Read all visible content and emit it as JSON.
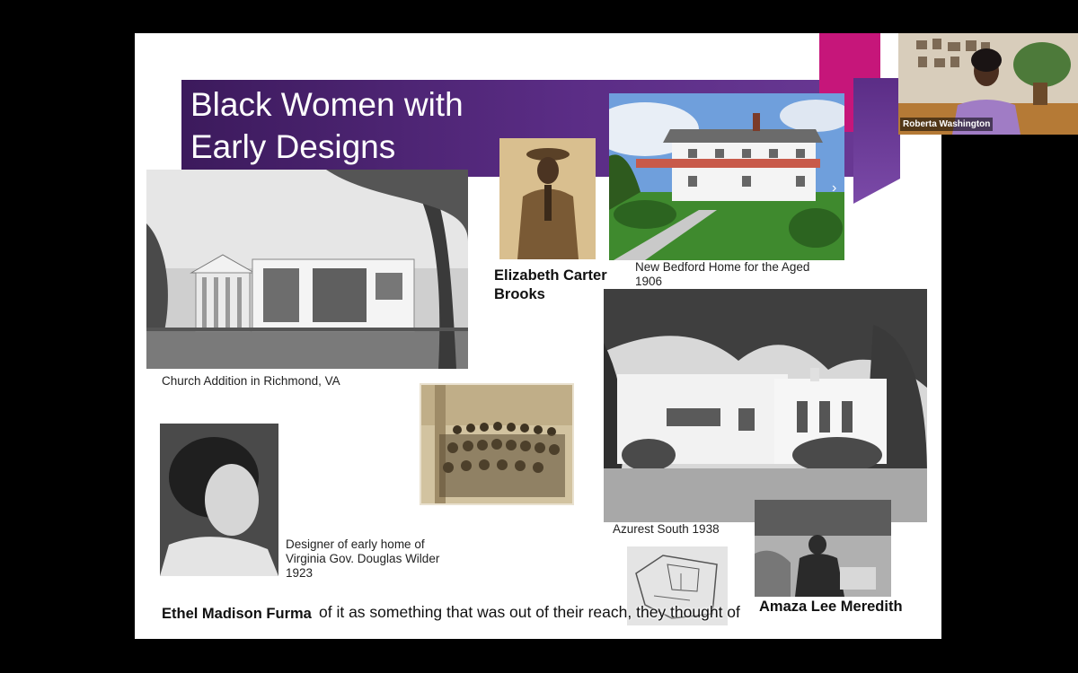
{
  "slide": {
    "title_line1": "Black Women with",
    "title_line2": "Early Designs",
    "captions": {
      "church": "Church Addition in Richmond, VA",
      "ecb_name": "Elizabeth Carter Brooks",
      "new_bedford_line1": "New Bedford Home for the Aged",
      "new_bedford_line2": "1906",
      "azurest": "Azurest South 1938",
      "designer_line1": "Designer  of early home of",
      "designer_line2": "Virginia Gov. Douglas Wilder",
      "designer_line3": "1923",
      "ethel_name": "Ethel Madison Furma",
      "amaza_name": "Amaza Lee Meredith"
    }
  },
  "video": {
    "participant_name": "Roberta Washington",
    "subtitle": "of it as something that was out of their reach, they thought of"
  },
  "colors": {
    "band_purple": "#5b2d86",
    "band_magenta": "#c6167a",
    "background": "#000000"
  }
}
